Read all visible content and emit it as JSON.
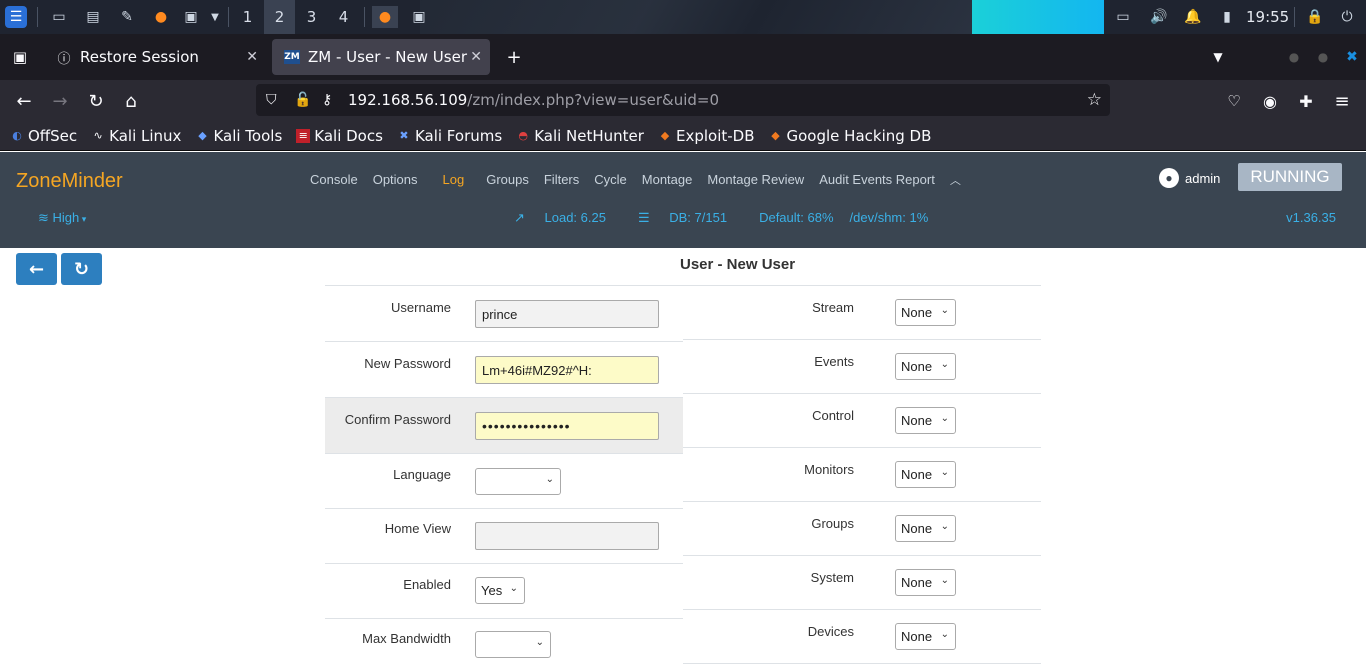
{
  "taskbar": {
    "workspaces": [
      "1",
      "2",
      "3",
      "4"
    ],
    "active_workspace": "2",
    "clock": "19:55"
  },
  "browser": {
    "tabs": [
      {
        "label": "Restore Session",
        "active": false
      },
      {
        "label": "ZM - User - New User",
        "active": true
      }
    ],
    "url_host": "192.168.56.109",
    "url_path": "/zm/index.php?view=user&uid=0",
    "bookmarks": [
      "OffSec",
      "Kali Linux",
      "Kali Tools",
      "Kali Docs",
      "Kali Forums",
      "Kali NetHunter",
      "Exploit-DB",
      "Google Hacking DB"
    ]
  },
  "zm": {
    "logo": "ZoneMinder",
    "menu": [
      "Console",
      "Options",
      "Log",
      "Groups",
      "Filters",
      "Cycle",
      "Montage",
      "Montage Review",
      "Audit Events Report"
    ],
    "user": "admin",
    "state": "RUNNING",
    "bandwidth": "High",
    "load": "Load: 6.25",
    "db": "DB: 7/151",
    "default_disk": "Default: 68%",
    "shm": "/dev/shm: 1%",
    "version": "v1.36.35"
  },
  "page": {
    "title": "User - New User",
    "left_fields": [
      {
        "label": "Username",
        "value": "prince"
      },
      {
        "label": "New Password",
        "value": "Lm+46i#MZ92#^H:"
      },
      {
        "label": "Confirm Password",
        "value": "•••••••••••••••"
      },
      {
        "label": "Language",
        "value": ""
      },
      {
        "label": "Home View",
        "value": ""
      },
      {
        "label": "Enabled",
        "value": "Yes"
      },
      {
        "label": "Max Bandwidth",
        "value": ""
      }
    ],
    "right_fields": [
      {
        "label": "Stream",
        "value": "None"
      },
      {
        "label": "Events",
        "value": "None"
      },
      {
        "label": "Control",
        "value": "None"
      },
      {
        "label": "Monitors",
        "value": "None"
      },
      {
        "label": "Groups",
        "value": "None"
      },
      {
        "label": "System",
        "value": "None"
      },
      {
        "label": "Devices",
        "value": "None"
      }
    ]
  },
  "colors": {
    "zm_header": "#3a4551",
    "accent_orange": "#f5a623",
    "accent_blue": "#3ab0e6",
    "button_blue": "#2d7fbf"
  }
}
